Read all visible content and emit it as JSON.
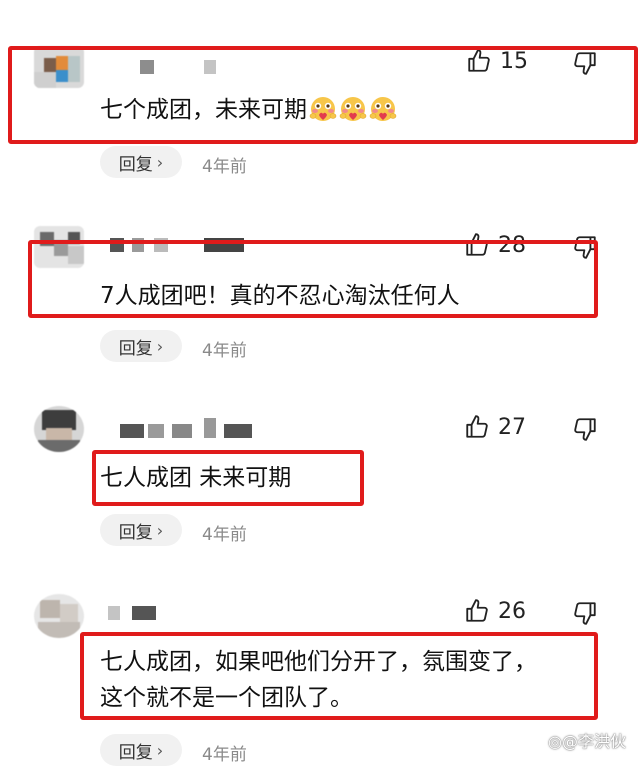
{
  "comments": [
    {
      "likes": "15",
      "text": "七个成团，未来可期",
      "reply": "回复",
      "chevron": "›",
      "time": "4年前",
      "emoji_count": 3
    },
    {
      "likes": "28",
      "text": "7人成团吧！真的不忍心淘汰任何人",
      "reply": "回复",
      "chevron": "›",
      "time": "4年前"
    },
    {
      "likes": "27",
      "text": "七人成团 未来可期",
      "reply": "回复",
      "chevron": "›",
      "time": "4年前"
    },
    {
      "likes": "26",
      "text_line1": "七人成团，如果吧他们分开了，氛围变了，",
      "text_line2": "这个就不是一个团队了。",
      "reply": "回复",
      "chevron": "›",
      "time": "4年前"
    }
  ],
  "watermark": "◎@李洪伙",
  "colors": {
    "highlight": "#e01b1b",
    "reply_bg": "#f1f1f1",
    "time": "#8a8a8a"
  },
  "icons": [
    "thumbs-up-icon",
    "thumbs-down-icon",
    "blush-heart-emoji"
  ]
}
